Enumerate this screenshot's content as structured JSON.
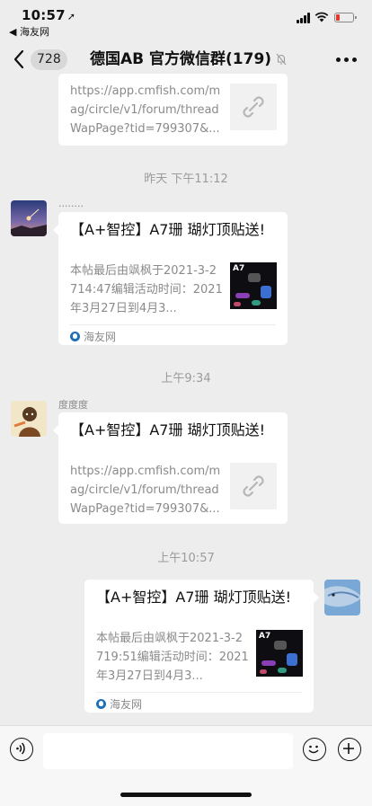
{
  "status": {
    "time": "10:57",
    "location_arrow": "➚",
    "back_app": "◀ 海友网",
    "icons": [
      "signal-icon",
      "wifi-icon",
      "battery-low-icon"
    ]
  },
  "nav": {
    "unread_count": "728",
    "title": "德国AB  官方微信群(179)",
    "icons": [
      "back-chevron-icon",
      "mute-bell-icon",
      "more-dots-icon"
    ]
  },
  "messages": [
    {
      "type": "link-card",
      "side": "left",
      "partial": true,
      "desc": "https://app.cmfish.com/mag/circle/v1/forum/threadWapPage?tid=799307&...",
      "thumb": "link-icon"
    },
    {
      "type": "timestamp",
      "text": "昨天 下午11:12"
    },
    {
      "type": "link-card",
      "side": "left",
      "sender": "........",
      "title": "【A+智控】A7珊 瑚灯顶贴送!",
      "desc": "本帖最后由飒枫于2021-3-2714:47编辑活动时间：2021年3月27日到4月3...",
      "thumb": "A7",
      "source": "海友网"
    },
    {
      "type": "timestamp",
      "text": "上午9:34"
    },
    {
      "type": "link-card",
      "side": "left",
      "sender": "度度度",
      "title": "【A+智控】A7珊 瑚灯顶贴送!",
      "desc": "https://app.cmfish.com/mag/circle/v1/forum/threadWapPage?tid=799307&...",
      "thumb": "link-icon"
    },
    {
      "type": "timestamp",
      "text": "上午10:57"
    },
    {
      "type": "link-card",
      "side": "right",
      "title": "【A+智控】A7珊 瑚灯顶贴送!",
      "desc": "本帖最后由飒枫于2021-3-2719:51编辑活动时间：2021年3月27日到4月3...",
      "thumb": "A7",
      "source": "海友网"
    }
  ],
  "bottom": {
    "icons": [
      "voice-icon",
      "emoji-icon",
      "plus-icon"
    ]
  }
}
